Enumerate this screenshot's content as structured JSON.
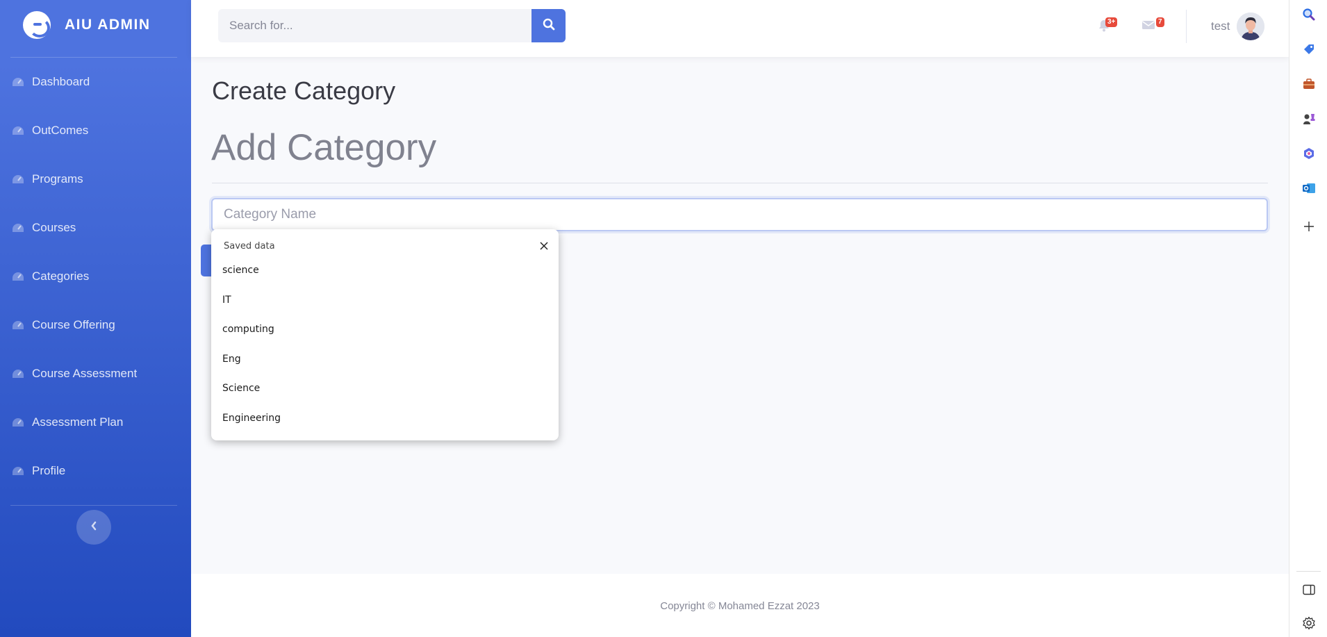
{
  "brand": {
    "name": "AIU ADMIN"
  },
  "sidebar": {
    "items": [
      {
        "label": "Dashboard"
      },
      {
        "label": "OutComes"
      },
      {
        "label": "Programs"
      },
      {
        "label": "Courses"
      },
      {
        "label": "Categories"
      },
      {
        "label": "Course Offering"
      },
      {
        "label": "Course Assessment"
      },
      {
        "label": "Assessment Plan"
      },
      {
        "label": "Profile"
      }
    ],
    "toggle_icon": "chevron-left-icon"
  },
  "topbar": {
    "search_placeholder": "Search for...",
    "alerts_badge": "3+",
    "messages_badge": "7",
    "user_name": "test"
  },
  "main": {
    "page_title": "Create Category",
    "section_title": "Add Category",
    "input_placeholder": "Category Name"
  },
  "autofill": {
    "header": "Saved data",
    "items": [
      "science",
      "IT",
      "computing",
      "Eng",
      "Science",
      "Engineering"
    ]
  },
  "footer": {
    "copyright": "Copyright © Mohamed Ezzat 2023"
  },
  "colors": {
    "primary": "#4e73df",
    "primary_dark": "#224abe",
    "badge": "#e74a3b"
  }
}
